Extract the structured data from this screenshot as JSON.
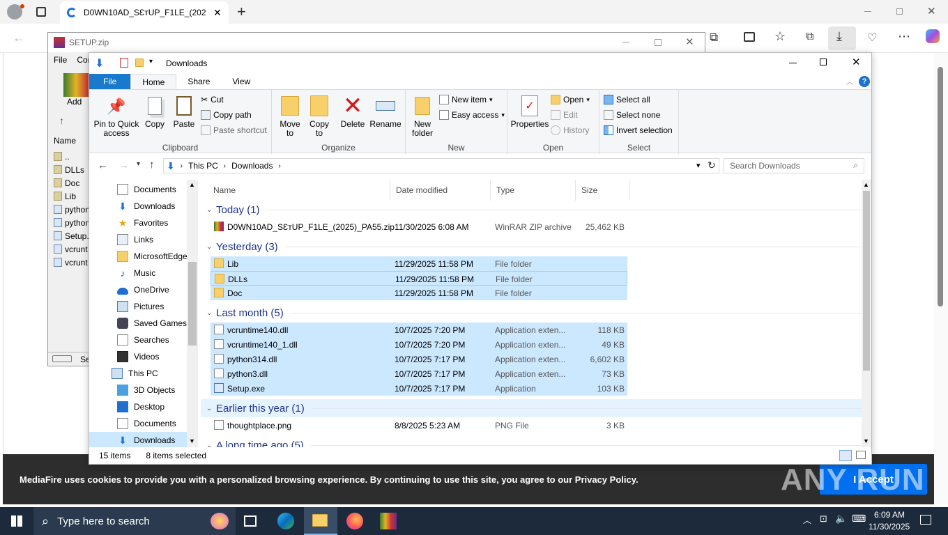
{
  "browser": {
    "tab_title": "D0WN10AD_SƐтUP_F1LE_(2025)_P",
    "new_tab": "+",
    "cookie_text": "MediaFire uses cookies to provide you with a personalized browsing experience. By continuing to use this site, you agree to our Privacy Policy.",
    "accept_label": "I Accept",
    "watermark": "ANY RUN"
  },
  "winrar": {
    "title": "SETUP.zip",
    "menu": [
      "File",
      "Cor"
    ],
    "add_label": "Add",
    "list_header": "Name",
    "files": [
      "..",
      "DLLs",
      "Doc",
      "Lib",
      "python",
      "python",
      "Setup.",
      "vcrunt",
      "vcrunt"
    ],
    "status_text": "Se"
  },
  "explorer": {
    "title": "Downloads",
    "tabs": [
      "File",
      "Home",
      "Share",
      "View"
    ],
    "clipboard": {
      "pin": "Pin to Quick access",
      "copy": "Copy",
      "paste": "Paste",
      "cut": "Cut",
      "copy_path": "Copy path",
      "paste_shortcut": "Paste shortcut",
      "label": "Clipboard"
    },
    "organize": {
      "move_to": "Move to",
      "copy_to": "Copy to",
      "delete": "Delete",
      "rename": "Rename",
      "label": "Organize"
    },
    "new": {
      "new_folder": "New folder",
      "new_item": "New item",
      "easy_access": "Easy access",
      "label": "New"
    },
    "open": {
      "properties": "Properties",
      "open": "Open",
      "edit": "Edit",
      "history": "History",
      "label": "Open"
    },
    "select": {
      "select_all": "Select all",
      "select_none": "Select none",
      "invert": "Invert selection",
      "label": "Select"
    },
    "address": {
      "crumbs": [
        "This PC",
        "Downloads"
      ],
      "search_placeholder": "Search Downloads"
    },
    "nav": [
      "Documents",
      "Downloads",
      "Favorites",
      "Links",
      "MicrosoftEdge",
      "Music",
      "OneDrive",
      "Pictures",
      "Saved Games",
      "Searches",
      "Videos",
      "This PC",
      "3D Objects",
      "Desktop",
      "Documents",
      "Downloads"
    ],
    "columns": [
      "Name",
      "Date modified",
      "Type",
      "Size"
    ],
    "groups": [
      {
        "title": "Today (1)",
        "rows": [
          {
            "name": "D0WN10AD_SƐтUP_F1LE_(2025)_PA55.zip",
            "date": "11/30/2025 6:08 AM",
            "type": "WinRAR ZIP archive",
            "size": "25,462 KB"
          }
        ]
      },
      {
        "title": "Yesterday (3)",
        "rows": [
          {
            "name": "Lib",
            "date": "11/29/2025 11:58 PM",
            "type": "File folder",
            "size": ""
          },
          {
            "name": "DLLs",
            "date": "11/29/2025 11:58 PM",
            "type": "File folder",
            "size": ""
          },
          {
            "name": "Doc",
            "date": "11/29/2025 11:58 PM",
            "type": "File folder",
            "size": ""
          }
        ]
      },
      {
        "title": "Last month (5)",
        "rows": [
          {
            "name": "vcruntime140.dll",
            "date": "10/7/2025 7:20 PM",
            "type": "Application exten...",
            "size": "118 KB"
          },
          {
            "name": "vcruntime140_1.dll",
            "date": "10/7/2025 7:20 PM",
            "type": "Application exten...",
            "size": "49 KB"
          },
          {
            "name": "python314.dll",
            "date": "10/7/2025 7:17 PM",
            "type": "Application exten...",
            "size": "6,602 KB"
          },
          {
            "name": "python3.dll",
            "date": "10/7/2025 7:17 PM",
            "type": "Application exten...",
            "size": "73 KB"
          },
          {
            "name": "Setup.exe",
            "date": "10/7/2025 7:17 PM",
            "type": "Application",
            "size": "103 KB"
          }
        ]
      },
      {
        "title": "Earlier this year (1)",
        "rows": [
          {
            "name": "thoughtplace.png",
            "date": "8/8/2025 5:23 AM",
            "type": "PNG File",
            "size": "3 KB"
          }
        ]
      },
      {
        "title": "A long time ago (5)",
        "rows": []
      }
    ],
    "status": {
      "items": "15 items",
      "selected": "8 items selected"
    }
  },
  "taskbar": {
    "search_placeholder": "Type here to search",
    "time": "6:09 AM",
    "date": "11/30/2025"
  }
}
